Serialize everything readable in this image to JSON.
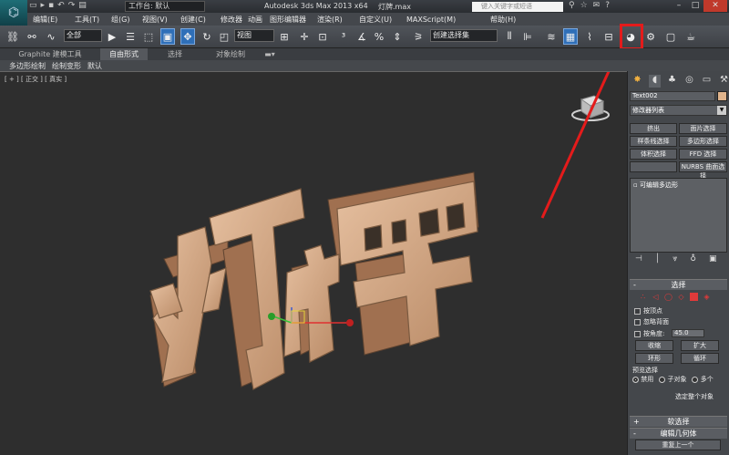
{
  "titlebar": {
    "workspace": "工作台: 默认",
    "app_title": "Autodesk 3ds Max  2013 x64",
    "file_name": "灯牌.max",
    "search_placeholder": "键入关键字或短语"
  },
  "menu": [
    "编辑(E)",
    "工具(T)",
    "组(G)",
    "视图(V)",
    "创建(C)",
    "修改器",
    "动画",
    "图形编辑器",
    "渲染(R)",
    "自定义(U)",
    "MAXScript(M)",
    "帮助(H)"
  ],
  "toolbar": {
    "filter": "全部",
    "ref_coord": "视图",
    "named_sel": "创建选择集"
  },
  "ribbon": {
    "tabs": [
      "Graphite 建模工具",
      "自由形式",
      "选择",
      "对象绘制"
    ],
    "sub": [
      "多边形绘制",
      "绘制变形",
      "默认"
    ]
  },
  "viewport": {
    "label": "[ + ] [ 正交 ] [ 真实 ]",
    "model_text": "灯牌",
    "model_color": "#d7a982"
  },
  "command_panel": {
    "object_name": "Text002",
    "object_color": "#e0b48c",
    "modifier_list": "修改器列表",
    "mod_buttons": [
      "挤出",
      "面片选择",
      "样条线选择",
      "多边形选择",
      "体积选择",
      "FFD 选择",
      "",
      "NURBS 曲面选择"
    ],
    "stack_item": "可编辑多边形",
    "selection": {
      "title": "选择",
      "by_vertex": "按顶点",
      "ignore_back": "忽略背面",
      "by_angle": "按角度:",
      "angle_value": "45.0",
      "shrink": "收缩",
      "grow": "扩大",
      "ring": "环形",
      "loop": "循环",
      "preview": "预览选择",
      "disabled": "禁用",
      "subobject": "子对象",
      "multi": "多个",
      "whole_object": "选定整个对象"
    },
    "soft_selection": "软选择",
    "edit_geometry": "编辑几何体",
    "repeat_last": "重复上一个"
  },
  "annotation": {
    "highlight_color": "#e41b1b"
  }
}
